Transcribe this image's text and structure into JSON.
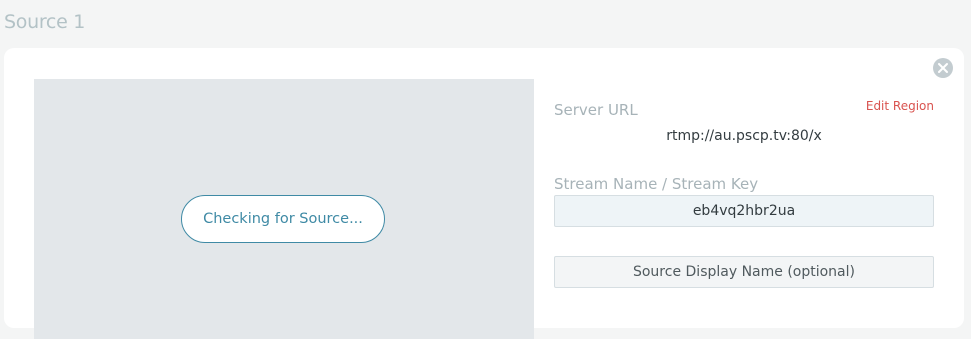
{
  "page": {
    "title": "Source 1"
  },
  "source": {
    "checking_label": "Checking for Source...",
    "edit_region_label": "Edit Region",
    "server_url_label": "Server URL",
    "server_url_value": "rtmp://au.pscp.tv:80/x",
    "stream_key_label": "Stream Name / Stream Key",
    "stream_key_value": "eb4vq2hbr2ua",
    "display_name_placeholder": "Source Display Name (optional)",
    "display_name_value": ""
  },
  "icons": {
    "close": "close-circle-icon"
  },
  "colors": {
    "accent": "#3f8aa5",
    "edit_region": "#d9534f",
    "label": "#a7b3b8",
    "preview_bg": "#e3e7ea"
  }
}
